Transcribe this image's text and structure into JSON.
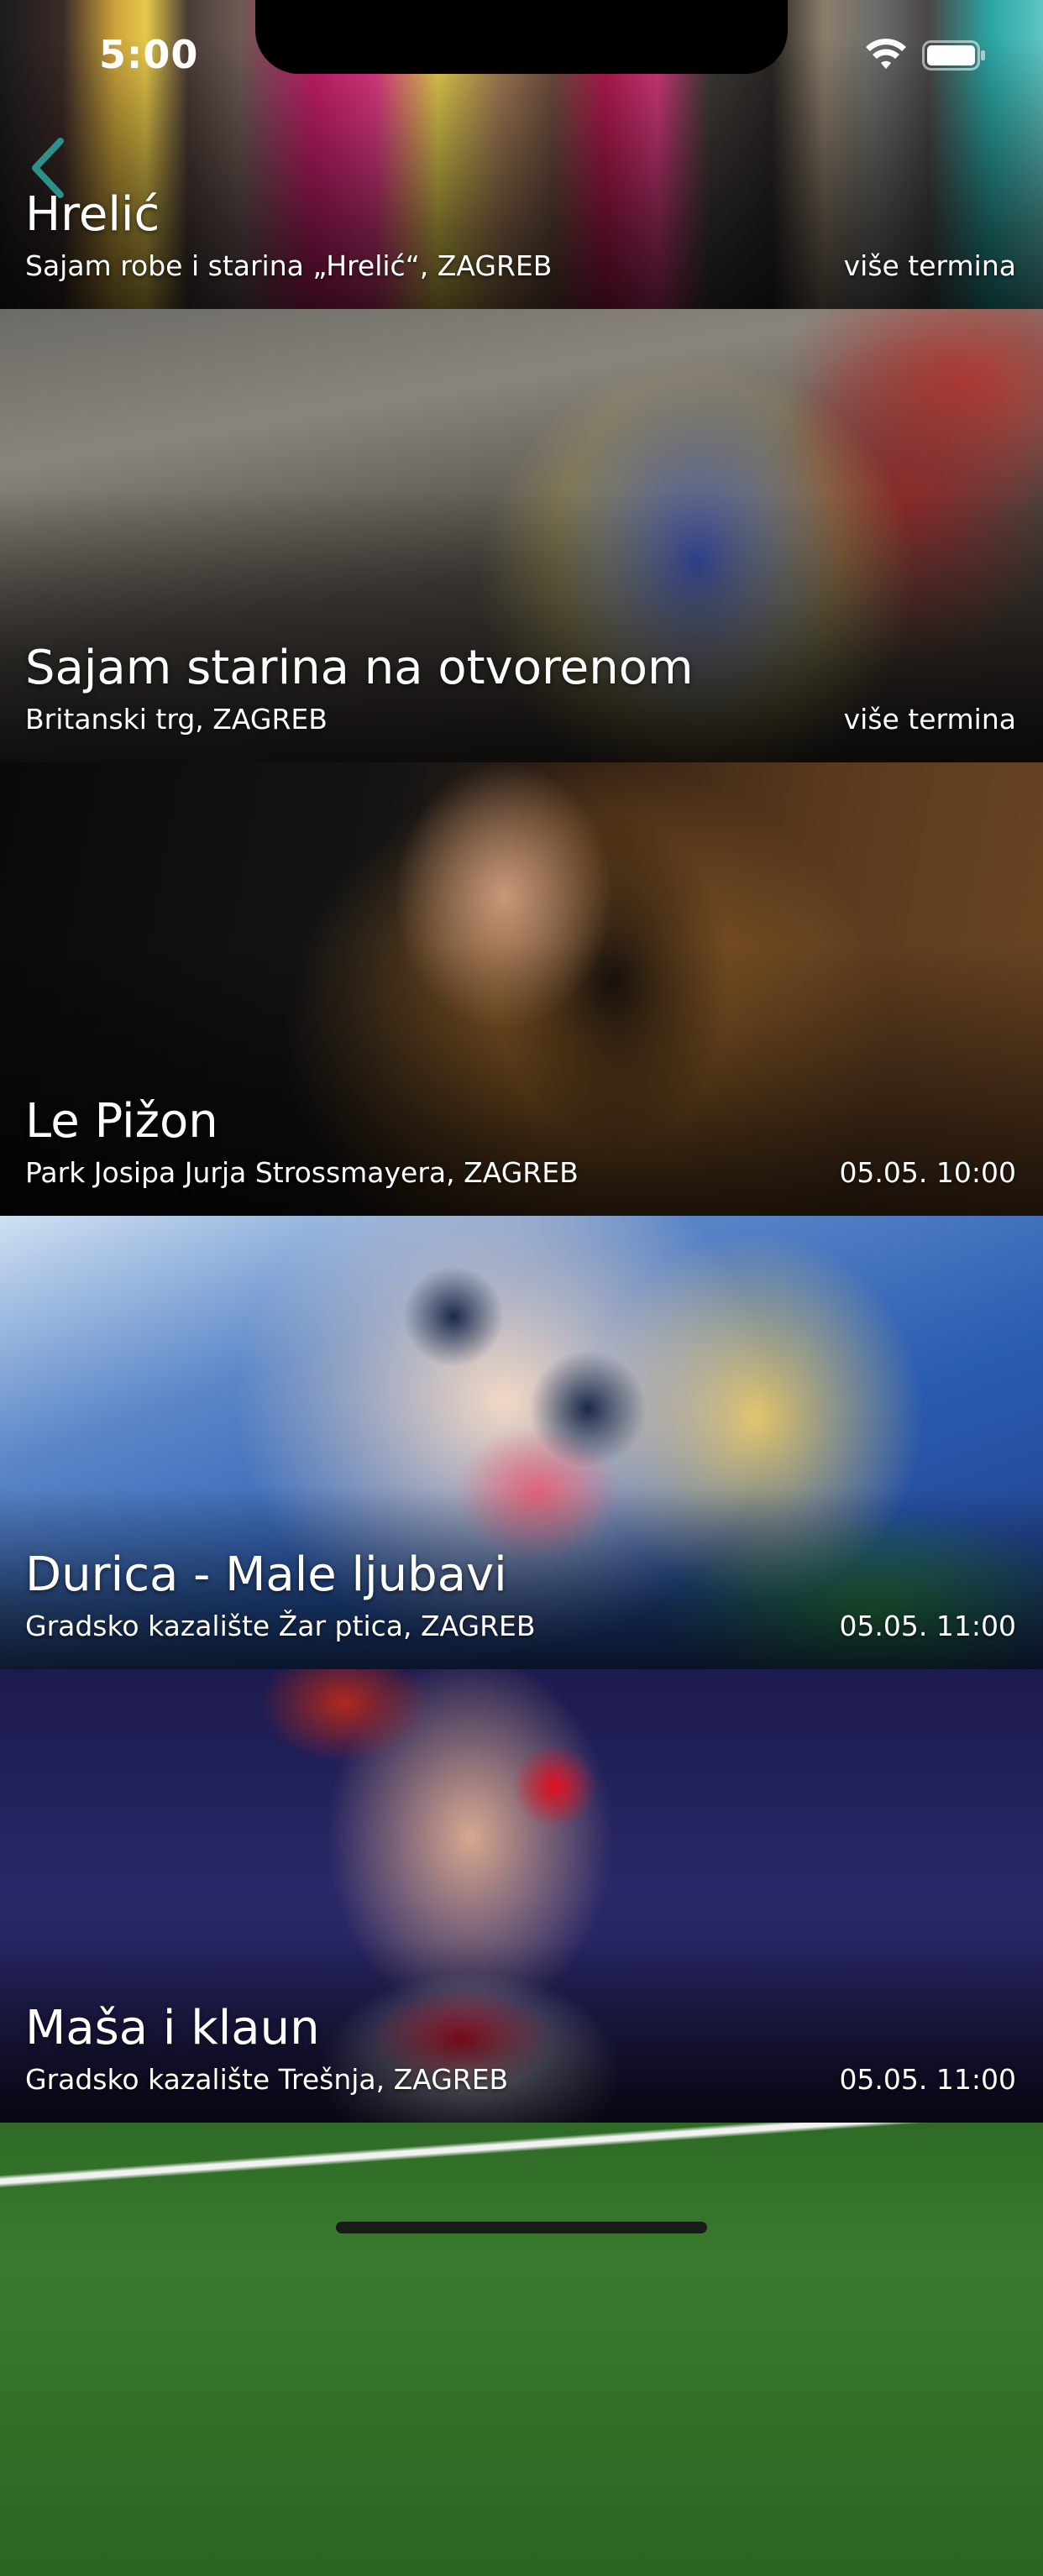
{
  "status_bar": {
    "time": "5:00"
  },
  "navigation": {
    "back_icon": "chevron-left-icon",
    "accent_color": "#2f8f8a"
  },
  "events": [
    {
      "title": "Hrelić",
      "venue": "Sajam robe i starina „Hrelić“, ZAGREB",
      "when": "više termina",
      "image": "clothes rack photo"
    },
    {
      "title": "Sajam starina na otvorenom",
      "venue": "Britanski trg, ZAGREB",
      "when": "više termina",
      "image": "antique paintings photo"
    },
    {
      "title": "Le Pižon",
      "venue": "Park Josipa Jurja Strossmayera, ZAGREB",
      "when": "05.05. 10:00",
      "image": "guitar player photo"
    },
    {
      "title": "Durica - Male ljubavi",
      "venue": "Gradsko kazalište Žar ptica, ZAGREB",
      "when": "05.05. 11:00",
      "image": "painted doll illustration"
    },
    {
      "title": "Maša i klaun",
      "venue": "Gradsko kazalište Trešnja, ZAGREB",
      "when": "05.05. 11:00",
      "image": "clown photo"
    },
    {
      "title": "",
      "venue": "",
      "when": "",
      "image": "football field photo"
    }
  ]
}
